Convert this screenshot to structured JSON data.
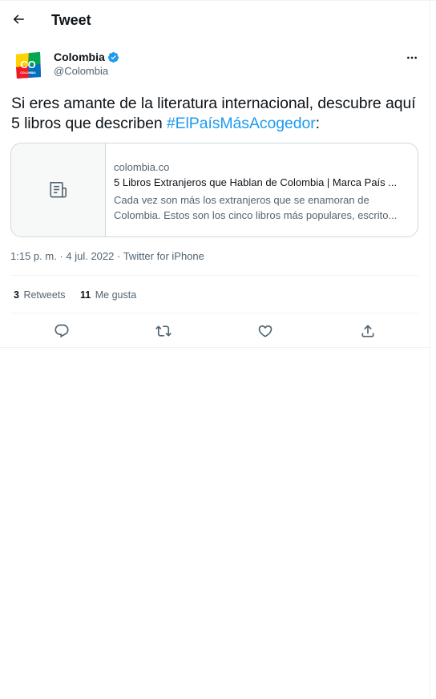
{
  "header": {
    "title": "Tweet",
    "back_icon": "arrow-left-icon"
  },
  "author": {
    "name": "Colombia",
    "handle": "@Colombia",
    "verified": true,
    "avatar_text": "CO",
    "avatar_subtext": "COLOMBIA"
  },
  "tweet": {
    "text_before": "Si eres amante de la literatura internacional, descubre aquí 5 libros que describen ",
    "hashtag": "#ElPaísMásAcogedor",
    "text_after": ":"
  },
  "card": {
    "domain": "colombia.co",
    "title": "5 Libros Extranjeros que Hablan de Colombia | Marca País ...",
    "description": "Cada vez son más los extranjeros que se enamoran de Colombia. Estos son los cinco libros más populares, escrito...",
    "icon": "article-icon"
  },
  "meta": {
    "time": "1:15 p. m.",
    "separator1": " · ",
    "date": "4 jul. 2022",
    "separator2": " · ",
    "source": "Twitter for iPhone"
  },
  "stats": {
    "retweets_count": "3",
    "retweets_label": "Retweets",
    "likes_count": "11",
    "likes_label": "Me gusta"
  },
  "actions": [
    "reply-icon",
    "retweet-icon",
    "like-icon",
    "share-icon"
  ],
  "colors": {
    "accent": "#1d9bf0",
    "text": "#0f1419",
    "secondary": "#536471",
    "border": "#cfd9de"
  }
}
